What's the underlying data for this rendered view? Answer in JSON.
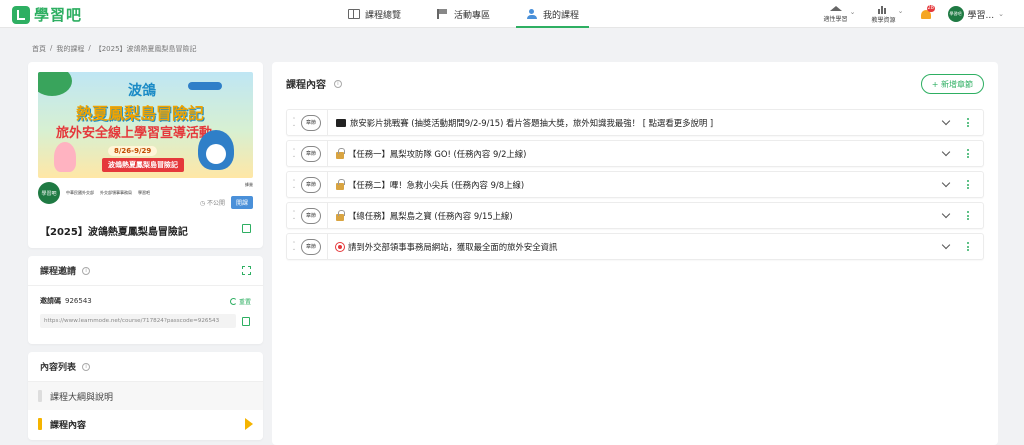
{
  "app": {
    "logo_text": "學習吧"
  },
  "nav": {
    "items": [
      {
        "label": "課程總覽",
        "icon": "book-icon"
      },
      {
        "label": "活動專區",
        "icon": "flag-icon"
      },
      {
        "label": "我的課程",
        "icon": "person-icon",
        "active": true
      }
    ]
  },
  "tools": {
    "learn": "適性學習",
    "resource": "教學資源",
    "notifications": "28",
    "user_avatar": "學習吧",
    "user_name": "學習..."
  },
  "breadcrumb": {
    "home": "首頁",
    "sep": "/",
    "my_courses": "我的課程",
    "current": "【2025】波鴿熱夏鳳梨島冒險記"
  },
  "banner": {
    "title1": "波鴿",
    "title2": "熱夏鳳梨島冒險記",
    "title3": "旅外安全線上學習宣導活動",
    "date": "8/26-9/29",
    "event": "波鴿熱夏鳳梨島冒險記",
    "sponsor1": "中華民國外交部",
    "sponsor2": "外交部領事事務局",
    "sponsor3": "學習吧",
    "badge_right": "蜂巢"
  },
  "course": {
    "logo": "學習吧",
    "visibility": "不公開",
    "open_label": "開課",
    "title": "【2025】波鴿熱夏鳳梨島冒險記"
  },
  "invite": {
    "title": "課程邀請",
    "code_label": "邀請碼",
    "code": "926543",
    "reset_label": "重置",
    "url": "https://www.learnmode.net/course/717824?passcode=926543"
  },
  "content_list": {
    "title": "內容列表",
    "items": [
      {
        "label": "課程大綱與說明"
      },
      {
        "label": "課程內容"
      }
    ]
  },
  "main": {
    "title": "課程內容",
    "add_label": "+ 新增章節",
    "badge": "章節",
    "rows": [
      {
        "icon": "tv-icon",
        "title": "旅安影片挑戰賽 (抽獎活動期間9/2-9/15) 看片答題抽大獎，旅外知識我最強！ [ 點選看更多說明 ]"
      },
      {
        "icon": "lock-icon",
        "title": "【任務一】鳳梨攻防隊 GO! (任務內容 9/2上線)"
      },
      {
        "icon": "lock-icon",
        "title": "【任務二】嗶！急救小尖兵 (任務內容 9/8上線)"
      },
      {
        "icon": "lock-icon",
        "title": "【總任務】鳳梨島之寶 (任務內容 9/15上線)"
      },
      {
        "icon": "pin-icon",
        "title": "請到外交部領事事務局網站，獲取最全面的旅外安全資訊"
      }
    ]
  },
  "colors": {
    "brand": "#2eaf62",
    "accent_yellow": "#f5b400",
    "link_blue": "#4a90d9"
  }
}
